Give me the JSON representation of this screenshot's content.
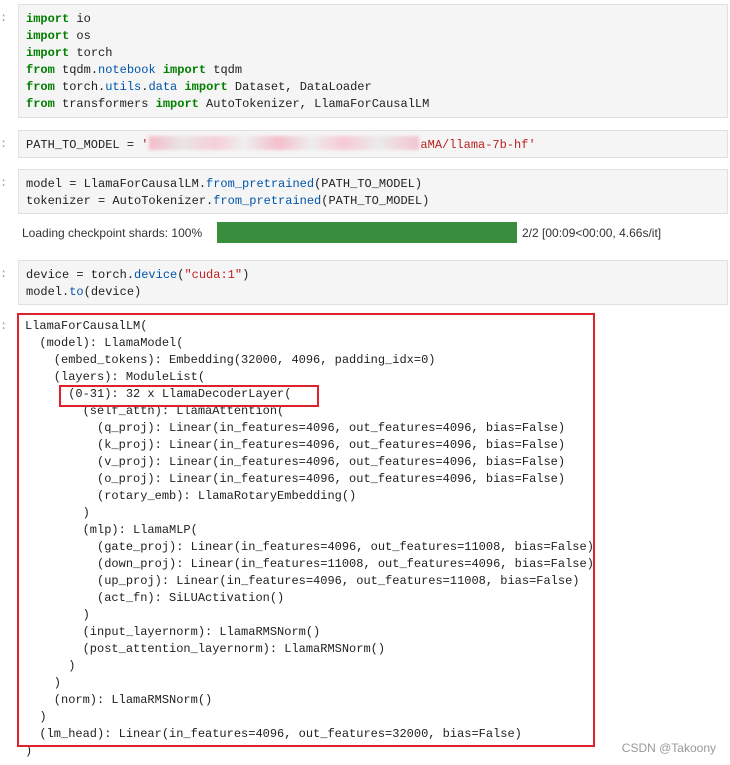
{
  "prompts": [
    ":",
    ":",
    ":",
    ":",
    ":"
  ],
  "cell1": {
    "lines": [
      [
        {
          "t": "import",
          "c": "kw"
        },
        {
          "t": " io"
        }
      ],
      [
        {
          "t": "import",
          "c": "kw"
        },
        {
          "t": " os"
        }
      ],
      [
        {
          "t": "import",
          "c": "kw"
        },
        {
          "t": " torch"
        }
      ],
      [
        {
          "t": "from",
          "c": "kw"
        },
        {
          "t": " tqdm."
        },
        {
          "t": "notebook",
          "c": "fn"
        },
        {
          "t": " "
        },
        {
          "t": "import",
          "c": "kw"
        },
        {
          "t": " tqdm"
        }
      ],
      [
        {
          "t": "from",
          "c": "kw"
        },
        {
          "t": " torch."
        },
        {
          "t": "utils",
          "c": "fn"
        },
        {
          "t": "."
        },
        {
          "t": "data",
          "c": "fn"
        },
        {
          "t": " "
        },
        {
          "t": "import",
          "c": "kw"
        },
        {
          "t": " Dataset, DataLoader"
        }
      ],
      [
        {
          "t": "from",
          "c": "kw"
        },
        {
          "t": " transformers "
        },
        {
          "t": "import",
          "c": "kw"
        },
        {
          "t": " AutoTokenizer, LlamaForCausalLM"
        }
      ]
    ]
  },
  "cell2": {
    "prefix": "PATH_TO_MODEL = ",
    "quote_open": "'",
    "suffix": "aMA/llama-7b-hf'"
  },
  "cell3": {
    "lines": [
      [
        {
          "t": "model = LlamaForCausalLM."
        },
        {
          "t": "from_pretrained",
          "c": "fn"
        },
        {
          "t": "(PATH_TO_MODEL)"
        }
      ],
      [
        {
          "t": "tokenizer = AutoTokenizer."
        },
        {
          "t": "from_pretrained",
          "c": "fn"
        },
        {
          "t": "(PATH_TO_MODEL)"
        }
      ]
    ]
  },
  "progress": {
    "label": "Loading checkpoint shards: 100%",
    "fraction": 1.0,
    "status": "2/2 [00:09<00:00, 4.66s/it]"
  },
  "cell4": {
    "lines": [
      [
        {
          "t": "device = torch."
        },
        {
          "t": "device",
          "c": "fn"
        },
        {
          "t": "("
        },
        {
          "t": "\"cuda:1\"",
          "c": "str"
        },
        {
          "t": ")"
        }
      ],
      [
        {
          "t": "model."
        },
        {
          "t": "to",
          "c": "fn"
        },
        {
          "t": "(device)"
        }
      ]
    ]
  },
  "output_lines": [
    "LlamaForCausalLM(",
    "  (model): LlamaModel(",
    "    (embed_tokens): Embedding(32000, 4096, padding_idx=0)",
    "    (layers): ModuleList(",
    "      (0-31): 32 x LlamaDecoderLayer(",
    "        (self_attn): LlamaAttention(",
    "          (q_proj): Linear(in_features=4096, out_features=4096, bias=False)",
    "          (k_proj): Linear(in_features=4096, out_features=4096, bias=False)",
    "          (v_proj): Linear(in_features=4096, out_features=4096, bias=False)",
    "          (o_proj): Linear(in_features=4096, out_features=4096, bias=False)",
    "          (rotary_emb): LlamaRotaryEmbedding()",
    "        )",
    "        (mlp): LlamaMLP(",
    "          (gate_proj): Linear(in_features=4096, out_features=11008, bias=False)",
    "          (down_proj): Linear(in_features=11008, out_features=4096, bias=False)",
    "          (up_proj): Linear(in_features=4096, out_features=11008, bias=False)",
    "          (act_fn): SiLUActivation()",
    "        )",
    "        (input_layernorm): LlamaRMSNorm()",
    "        (post_attention_layernorm): LlamaRMSNorm()",
    "      )",
    "    )",
    "    (norm): LlamaRMSNorm()",
    "  )",
    "  (lm_head): Linear(in_features=4096, out_features=32000, bias=False)",
    ")"
  ],
  "watermark": "CSDN @Takoony",
  "colors": {
    "keyword": "#008000",
    "function": "#0055aa",
    "string": "#ba2121",
    "progress_fill": "#388e3c",
    "highlight_border": "#e0202a"
  }
}
